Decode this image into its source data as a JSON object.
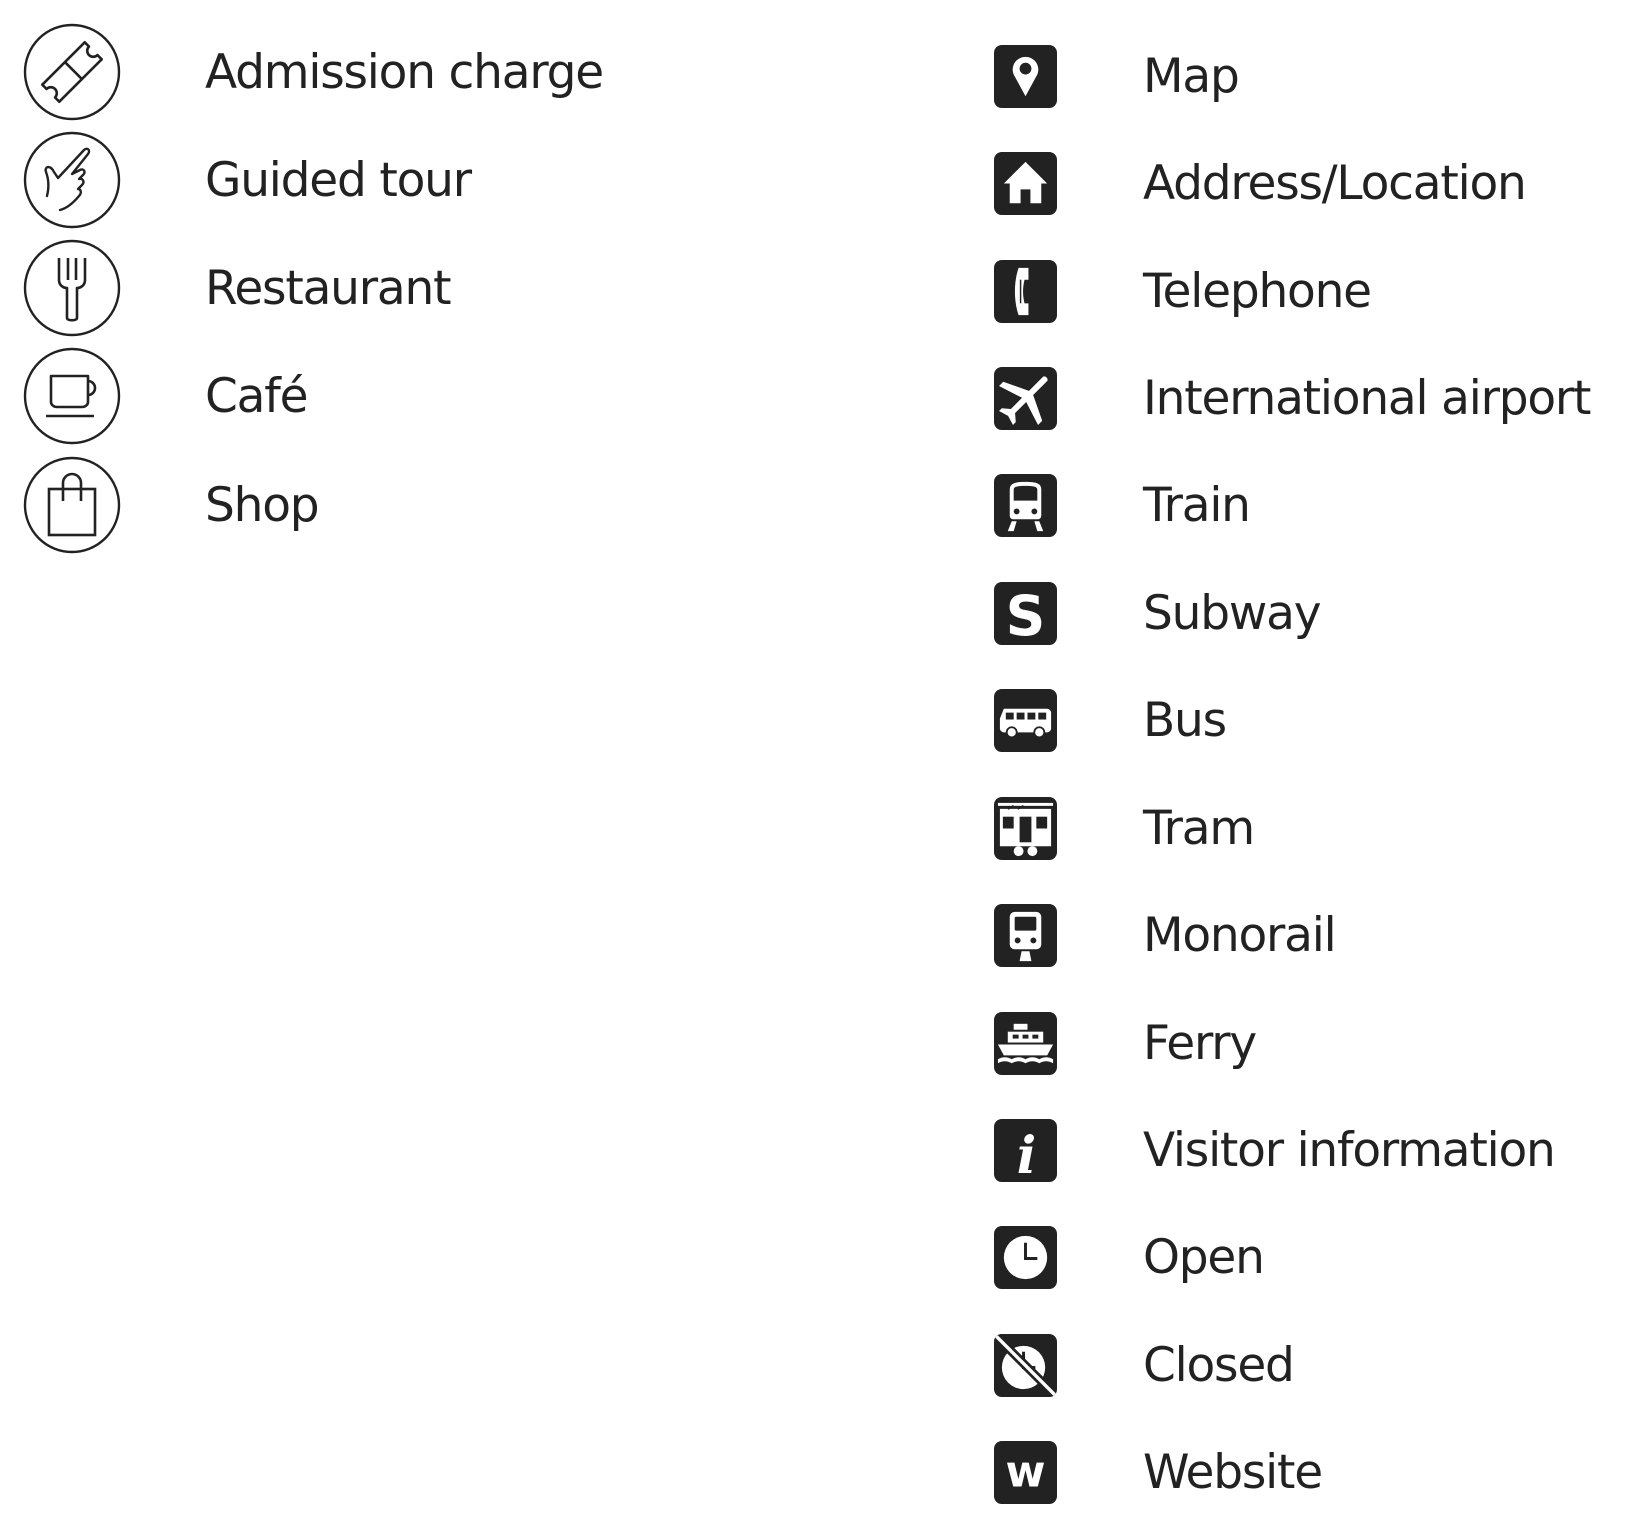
{
  "colors": {
    "ink": "#222222",
    "background": "#ffffff"
  },
  "left_column": {
    "items": [
      {
        "icon": "ticket-icon",
        "label": "Admission charge"
      },
      {
        "icon": "pointing-hand-icon",
        "label": "Guided tour"
      },
      {
        "icon": "fork-icon",
        "label": "Restaurant"
      },
      {
        "icon": "coffee-cup-icon",
        "label": "Café"
      },
      {
        "icon": "shopping-bag-icon",
        "label": "Shop"
      }
    ]
  },
  "right_column": {
    "items": [
      {
        "icon": "map-pin-icon",
        "label": "Map"
      },
      {
        "icon": "house-icon",
        "label": "Address/Location"
      },
      {
        "icon": "telephone-icon",
        "label": "Telephone"
      },
      {
        "icon": "airplane-icon",
        "label": "International airport"
      },
      {
        "icon": "train-icon",
        "label": "Train"
      },
      {
        "icon": "subway-icon",
        "label": "Subway",
        "glyph": "S"
      },
      {
        "icon": "bus-icon",
        "label": "Bus"
      },
      {
        "icon": "tram-icon",
        "label": "Tram"
      },
      {
        "icon": "monorail-icon",
        "label": "Monorail"
      },
      {
        "icon": "ferry-icon",
        "label": "Ferry"
      },
      {
        "icon": "info-icon",
        "label": "Visitor information",
        "glyph": "i"
      },
      {
        "icon": "clock-icon",
        "label": "Open"
      },
      {
        "icon": "clock-crossed-icon",
        "label": "Closed"
      },
      {
        "icon": "website-icon",
        "label": "Website",
        "glyph": "w"
      }
    ]
  }
}
